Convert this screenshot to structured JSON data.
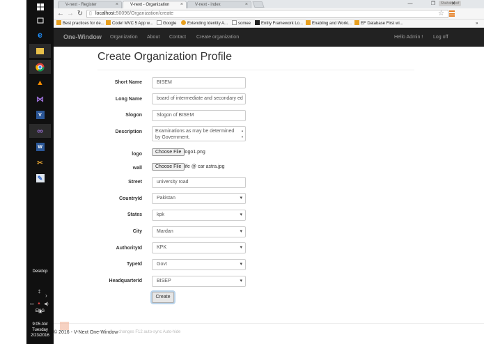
{
  "browser": {
    "tabs": [
      {
        "label": "V-next - Register"
      },
      {
        "label": "V-next - Organization"
      },
      {
        "label": "V-next - index"
      }
    ],
    "close_glyph": "×",
    "profile_label": "Shahab Asif",
    "window_controls": {
      "minimize": "—",
      "maximize": "❐",
      "close": "✕"
    },
    "url_host": "localhost:",
    "url_path": "50096/Organization/create",
    "bookmarks": [
      {
        "label": "Best practices for de...",
        "color": "#e8a020"
      },
      {
        "label": "Code! MVC 5 App w...",
        "color": "#e8a020"
      },
      {
        "label": "Google",
        "color": "#888888"
      },
      {
        "label": "Extending Identity A...",
        "color": "#e8a020"
      },
      {
        "label": "somee",
        "color": "#888888"
      },
      {
        "label": "Entity Framework Lo...",
        "color": "#222222"
      },
      {
        "label": "Enabling and Worki...",
        "color": "#e8a020"
      },
      {
        "label": "EF Database First wi...",
        "color": "#e8a020"
      }
    ],
    "bookmarks_overflow": "»"
  },
  "navbar": {
    "brand": "One-Window",
    "links": [
      "Organization",
      "About",
      "Contact",
      "Create organization"
    ],
    "greeting": "Hello Admin !",
    "logoff": "Log off"
  },
  "page": {
    "title": "Create Organization Profile",
    "fields": {
      "short_name": {
        "label": "Short Name",
        "value": "BISEM"
      },
      "long_name": {
        "label": "Long Name",
        "value": "board of intermediate and secondary ed"
      },
      "slogan": {
        "label": "Slogon",
        "value": "Slogon of BISEM"
      },
      "description": {
        "label": "Description",
        "value": "Examinations as may be determined by Government."
      },
      "logo": {
        "label": "logo",
        "button": "Choose File",
        "file": "logo1.png"
      },
      "wall": {
        "label": "wall",
        "button": "Choose File",
        "file": "life @ car astra.jpg"
      },
      "street": {
        "label": "Street",
        "value": "university road"
      },
      "country": {
        "label": "CountryId",
        "value": "Pakistan"
      },
      "states": {
        "label": "States",
        "value": "kpk"
      },
      "city": {
        "label": "City",
        "value": "Mardan"
      },
      "authority": {
        "label": "AuthorityId",
        "value": "KPK"
      },
      "type": {
        "label": "TypeId",
        "value": "Govt"
      },
      "headquarter": {
        "label": "HeadquarterId",
        "value": "BISEP"
      }
    },
    "submit": "Create",
    "footer": "© 2016 - V-Next One-Window",
    "devbar": "changes   F12 auto-sync   Auto-hide"
  },
  "taskbar": {
    "desktop_label": "Desktop",
    "lang": "ENG",
    "time": "9:05 AM",
    "day": "Tuesday",
    "date": "2/23/2016"
  },
  "colors": {
    "navbar_bg": "#222222",
    "taskbar_bg": "#101010",
    "accent": "#e67e22"
  }
}
